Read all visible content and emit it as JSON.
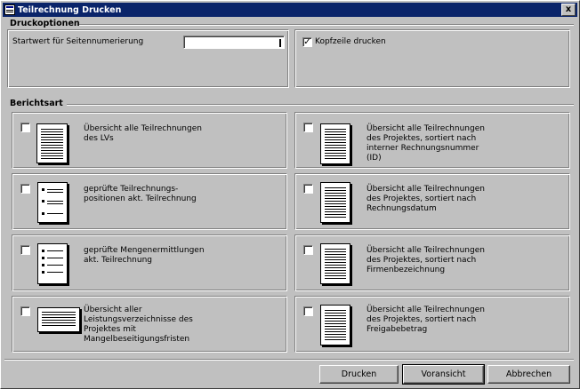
{
  "window": {
    "title": "Teilrechnung Drucken",
    "close_symbol": "x"
  },
  "druckoptionen": {
    "heading": "Druckoptionen",
    "startwert_label": "Startwert für Seitennumerierung",
    "startwert_value": "",
    "kopfzeile": {
      "label": "Kopfzeile drucken",
      "checked": true,
      "mark": "✓"
    }
  },
  "berichtsart": {
    "heading": "Berichtsart",
    "options": [
      {
        "text": "Übersicht alle Teilrechnungen\ndes LVs",
        "checked": false
      },
      {
        "text": "Übersicht alle Teilrechnungen\ndes Projektes, sortiert nach\ninterner Rechnungsnummer\n(ID)",
        "checked": false
      },
      {
        "text": "geprüfte Teilrechnungs-\npositionen akt. Teilrechnung",
        "checked": false
      },
      {
        "text": "Übersicht alle Teilrechnungen\ndes Projektes, sortiert nach\nRechnungsdatum",
        "checked": false
      },
      {
        "text": "geprüfte Mengenermittlungen\nakt. Teilrechnung",
        "checked": false
      },
      {
        "text": "Übersicht alle Teilrechnungen\ndes Projektes, sortiert nach\nFirmenbezeichnung",
        "checked": false
      },
      {
        "text": "Übersicht aller\nLeistungsverzeichnisse des\nProjektes mit\nMangelbeseitigungsfristen",
        "checked": false
      },
      {
        "text": "Übersicht alle Teilrechnungen\ndes Projektes, sortiert nach\nFreigabebetrag",
        "checked": false
      }
    ]
  },
  "buttons": {
    "drucken": "Drucken",
    "voransicht": "Voransicht",
    "abbrechen": "Abbrechen"
  }
}
